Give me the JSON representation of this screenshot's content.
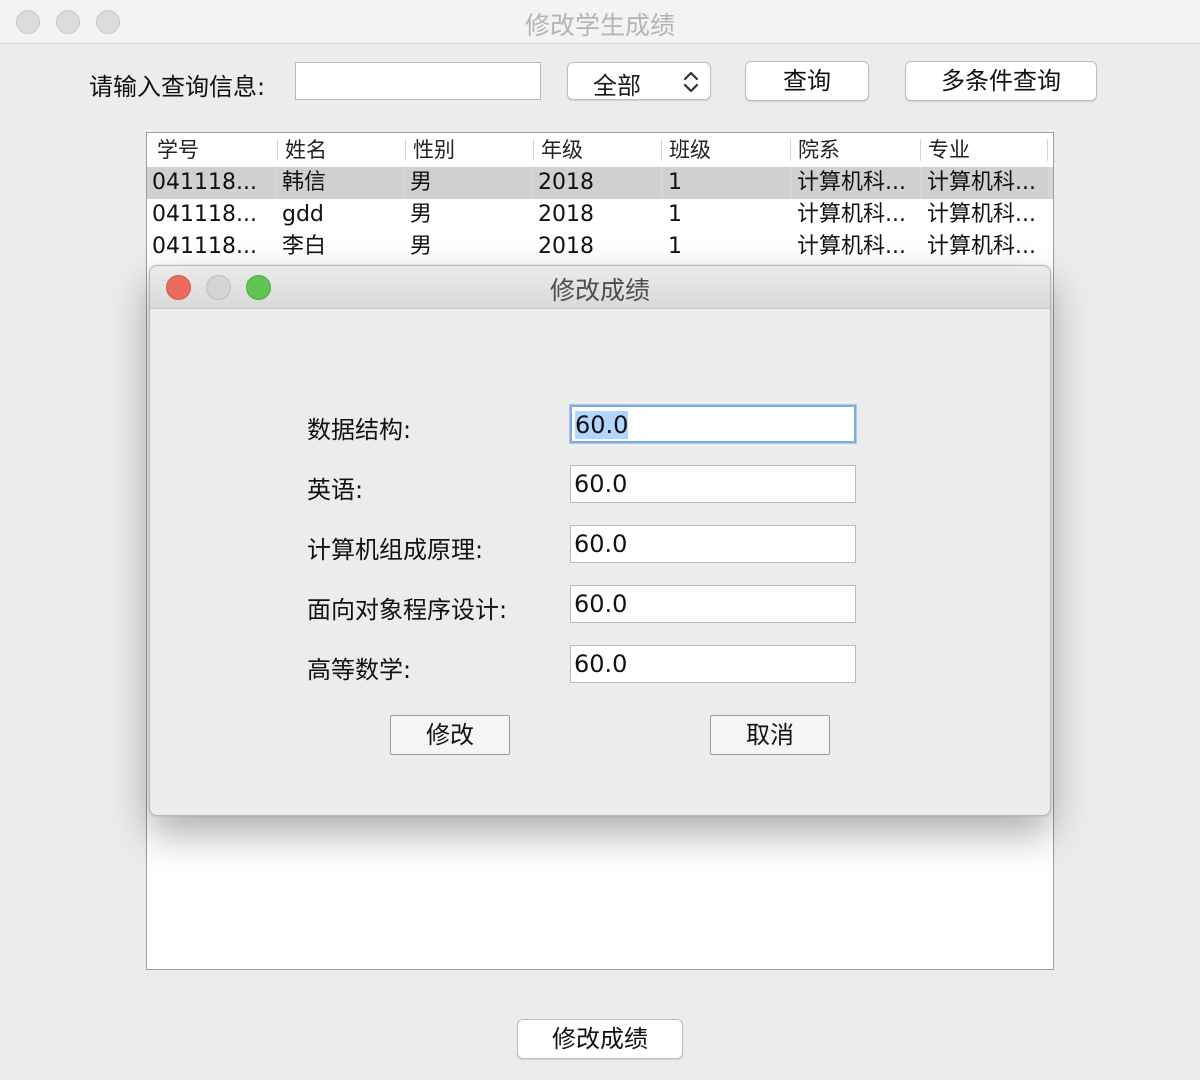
{
  "window": {
    "title": "修改学生成绩"
  },
  "toolbar": {
    "search_label": "请输入查询信息:",
    "search_value": "",
    "filter_selected": "全部",
    "query_label": "查询",
    "multi_query_label": "多条件查询"
  },
  "table": {
    "headers": [
      "学号",
      "姓名",
      "性别",
      "年级",
      "班级",
      "院系",
      "专业"
    ],
    "rows": [
      [
        "041118...",
        "韩信",
        "男",
        "2018",
        "1",
        "计算机科...",
        "计算机科..."
      ],
      [
        "041118...",
        "gdd",
        "男",
        "2018",
        "1",
        "计算机科...",
        "计算机科..."
      ],
      [
        "041118...",
        "李白",
        "男",
        "2018",
        "1",
        "计算机科...",
        "计算机科..."
      ]
    ],
    "selected_row": 0
  },
  "bottom": {
    "edit_scores_label": "修改成绩"
  },
  "dialog": {
    "title": "修改成绩",
    "fields": [
      {
        "label": "数据结构:",
        "value": "60.0"
      },
      {
        "label": "英语:",
        "value": "60.0"
      },
      {
        "label": "计算机组成原理:",
        "value": "60.0"
      },
      {
        "label": "面向对象程序设计:",
        "value": "60.0"
      },
      {
        "label": "高等数学:",
        "value": "60.0"
      }
    ],
    "confirm_label": "修改",
    "cancel_label": "取消"
  },
  "colors": {
    "close": "#ed6a5e",
    "minimize": "#d4d4d4",
    "zoom": "#61c554",
    "selection": "#b3d4fc",
    "focus_ring": "#7eaadf"
  },
  "icons": {
    "dialog_close": "close-icon",
    "dialog_minimize": "minimize-icon",
    "dialog_zoom": "zoom-icon",
    "select_chevron": "chevron-updown-icon"
  }
}
